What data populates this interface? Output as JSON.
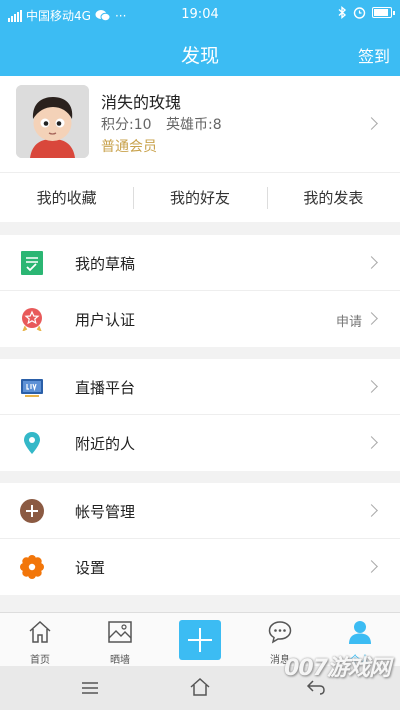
{
  "status_bar": {
    "carrier": "中国移动4G",
    "time": "19:04"
  },
  "nav": {
    "title": "发现",
    "checkin_label": "签到"
  },
  "profile": {
    "name": "消失的玫瑰",
    "points_label": "积分:10",
    "coins_label": "英雄币:8",
    "level": "普通会员"
  },
  "quick_tabs": [
    "我的收藏",
    "我的好友",
    "我的发表"
  ],
  "menu": {
    "drafts": "我的草稿",
    "verify": "用户认证",
    "verify_extra": "申请",
    "live": "直播平台",
    "nearby": "附近的人",
    "account": "帐号管理",
    "settings": "设置"
  },
  "tabbar": {
    "home": "首页",
    "wall": "晒墙",
    "messages": "消息",
    "me": "个人"
  },
  "watermark": "007游戏网",
  "colors": {
    "primary": "#3cbcf3",
    "gold": "#c9a34e"
  }
}
